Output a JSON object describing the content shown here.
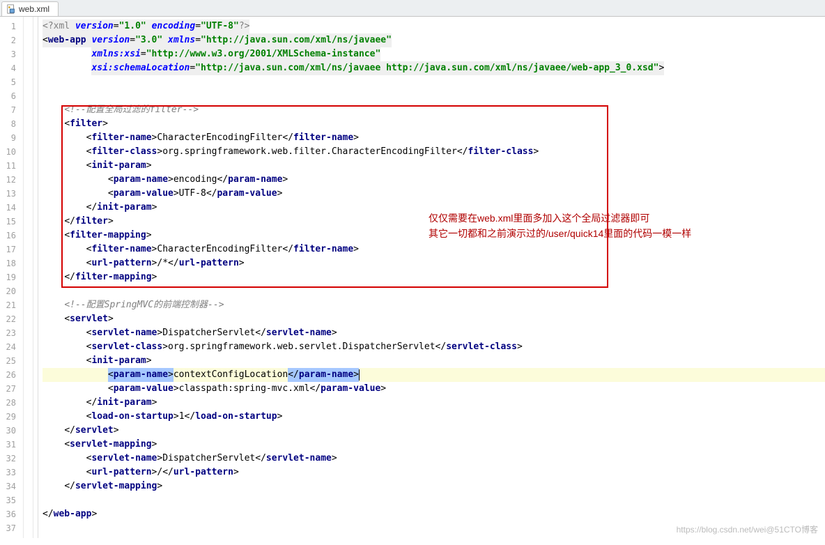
{
  "tab": {
    "title": "web.xml"
  },
  "gutter": {
    "start": 1,
    "end": 37
  },
  "highlight_line": 26,
  "red_box": {
    "from": 7,
    "to": 19
  },
  "annotation": {
    "line1": "仅仅需要在web.xml里面多加入这个全局过滤器即可",
    "line2": "其它一切都和之前演示过的/user/quick14里面的代码一模一样"
  },
  "watermark": "https://blog.csdn.net/wei@51CTO博客",
  "code": {
    "lines": [
      {
        "n": 1,
        "ind": 0,
        "seg": [
          {
            "c": "t-decl bg-decl",
            "t": "<?xml"
          },
          {
            "c": "bg-decl",
            "t": " "
          },
          {
            "c": "t-attr bg-decl",
            "t": "version"
          },
          {
            "c": "bg-decl",
            "t": "="
          },
          {
            "c": "t-str bg-decl",
            "t": "\"1.0\""
          },
          {
            "c": "bg-decl",
            "t": " "
          },
          {
            "c": "t-attr bg-decl",
            "t": "encoding"
          },
          {
            "c": "bg-decl",
            "t": "="
          },
          {
            "c": "t-str bg-decl",
            "t": "\"UTF-8\""
          },
          {
            "c": "t-decl bg-decl",
            "t": "?>"
          }
        ]
      },
      {
        "n": 2,
        "ind": 0,
        "seg": [
          {
            "c": "t-punct bg-decl",
            "t": "<"
          },
          {
            "c": "t-tag bg-decl",
            "t": "web-app"
          },
          {
            "c": "bg-decl",
            "t": " "
          },
          {
            "c": "t-attr bg-decl",
            "t": "version"
          },
          {
            "c": "bg-decl",
            "t": "="
          },
          {
            "c": "t-str bg-decl",
            "t": "\"3.0\""
          },
          {
            "c": "bg-decl",
            "t": " "
          },
          {
            "c": "t-attr bg-decl",
            "t": "xmlns"
          },
          {
            "c": "bg-decl",
            "t": "="
          },
          {
            "c": "t-str bg-decl",
            "t": "\"http://java.sun.com/xml/ns/javaee\""
          }
        ]
      },
      {
        "n": 3,
        "ind": 9,
        "seg": [
          {
            "c": "t-attr bg-decl",
            "t": "xmlns:xsi"
          },
          {
            "c": "bg-decl",
            "t": "="
          },
          {
            "c": "t-str bg-decl",
            "t": "\"http://www.w3.org/2001/XMLSchema-instance\""
          }
        ]
      },
      {
        "n": 4,
        "ind": 9,
        "seg": [
          {
            "c": "t-attr bg-decl",
            "t": "xsi:schemaLocation"
          },
          {
            "c": "bg-decl",
            "t": "="
          },
          {
            "c": "t-str bg-decl",
            "t": "\"http://java.sun.com/xml/ns/javaee http://java.sun.com/xml/ns/javaee/web-app_3_0.xsd\""
          },
          {
            "c": "t-punct bg-decl",
            "t": ">"
          }
        ]
      },
      {
        "n": 5,
        "ind": 0,
        "seg": []
      },
      {
        "n": 6,
        "ind": 0,
        "seg": []
      },
      {
        "n": 7,
        "ind": 4,
        "seg": [
          {
            "c": "t-cmt",
            "t": "<!--配置全局过滤的filter-->"
          }
        ]
      },
      {
        "n": 8,
        "ind": 4,
        "seg": [
          {
            "c": "t-punct",
            "t": "<"
          },
          {
            "c": "t-tag",
            "t": "filter"
          },
          {
            "c": "t-punct",
            "t": ">"
          }
        ]
      },
      {
        "n": 9,
        "ind": 8,
        "seg": [
          {
            "c": "t-punct",
            "t": "<"
          },
          {
            "c": "t-tag",
            "t": "filter-name"
          },
          {
            "c": "t-punct",
            "t": ">"
          },
          {
            "c": "t-txt",
            "t": "CharacterEncodingFilter"
          },
          {
            "c": "t-punct",
            "t": "</"
          },
          {
            "c": "t-tag",
            "t": "filter-name"
          },
          {
            "c": "t-punct",
            "t": ">"
          }
        ]
      },
      {
        "n": 10,
        "ind": 8,
        "seg": [
          {
            "c": "t-punct",
            "t": "<"
          },
          {
            "c": "t-tag",
            "t": "filter-class"
          },
          {
            "c": "t-punct",
            "t": ">"
          },
          {
            "c": "t-txt",
            "t": "org.springframework.web.filter.CharacterEncodingFilter"
          },
          {
            "c": "t-punct",
            "t": "</"
          },
          {
            "c": "t-tag",
            "t": "filter-class"
          },
          {
            "c": "t-punct",
            "t": ">"
          }
        ]
      },
      {
        "n": 11,
        "ind": 8,
        "seg": [
          {
            "c": "t-punct",
            "t": "<"
          },
          {
            "c": "t-tag",
            "t": "init-param"
          },
          {
            "c": "t-punct",
            "t": ">"
          }
        ]
      },
      {
        "n": 12,
        "ind": 12,
        "seg": [
          {
            "c": "t-punct",
            "t": "<"
          },
          {
            "c": "t-tag",
            "t": "param-name"
          },
          {
            "c": "t-punct",
            "t": ">"
          },
          {
            "c": "t-txt",
            "t": "encoding"
          },
          {
            "c": "t-punct",
            "t": "</"
          },
          {
            "c": "t-tag",
            "t": "param-name"
          },
          {
            "c": "t-punct",
            "t": ">"
          }
        ]
      },
      {
        "n": 13,
        "ind": 12,
        "seg": [
          {
            "c": "t-punct",
            "t": "<"
          },
          {
            "c": "t-tag",
            "t": "param-value"
          },
          {
            "c": "t-punct",
            "t": ">"
          },
          {
            "c": "t-txt",
            "t": "UTF-8"
          },
          {
            "c": "t-punct",
            "t": "</"
          },
          {
            "c": "t-tag",
            "t": "param-value"
          },
          {
            "c": "t-punct",
            "t": ">"
          }
        ]
      },
      {
        "n": 14,
        "ind": 8,
        "seg": [
          {
            "c": "t-punct",
            "t": "</"
          },
          {
            "c": "t-tag",
            "t": "init-param"
          },
          {
            "c": "t-punct",
            "t": ">"
          }
        ]
      },
      {
        "n": 15,
        "ind": 4,
        "seg": [
          {
            "c": "t-punct",
            "t": "</"
          },
          {
            "c": "t-tag",
            "t": "filter"
          },
          {
            "c": "t-punct",
            "t": ">"
          }
        ]
      },
      {
        "n": 16,
        "ind": 4,
        "seg": [
          {
            "c": "t-punct",
            "t": "<"
          },
          {
            "c": "t-tag",
            "t": "filter-mapping"
          },
          {
            "c": "t-punct",
            "t": ">"
          }
        ]
      },
      {
        "n": 17,
        "ind": 8,
        "seg": [
          {
            "c": "t-punct",
            "t": "<"
          },
          {
            "c": "t-tag",
            "t": "filter-name"
          },
          {
            "c": "t-punct",
            "t": ">"
          },
          {
            "c": "t-txt",
            "t": "CharacterEncodingFilter"
          },
          {
            "c": "t-punct",
            "t": "</"
          },
          {
            "c": "t-tag",
            "t": "filter-name"
          },
          {
            "c": "t-punct",
            "t": ">"
          }
        ]
      },
      {
        "n": 18,
        "ind": 8,
        "seg": [
          {
            "c": "t-punct",
            "t": "<"
          },
          {
            "c": "t-tag",
            "t": "url-pattern"
          },
          {
            "c": "t-punct",
            "t": ">"
          },
          {
            "c": "t-txt",
            "t": "/*"
          },
          {
            "c": "t-punct",
            "t": "</"
          },
          {
            "c": "t-tag",
            "t": "url-pattern"
          },
          {
            "c": "t-punct",
            "t": ">"
          }
        ]
      },
      {
        "n": 19,
        "ind": 4,
        "seg": [
          {
            "c": "t-punct",
            "t": "</"
          },
          {
            "c": "t-tag",
            "t": "filter-mapping"
          },
          {
            "c": "t-punct",
            "t": ">"
          }
        ]
      },
      {
        "n": 20,
        "ind": 0,
        "seg": []
      },
      {
        "n": 21,
        "ind": 4,
        "seg": [
          {
            "c": "t-cmt",
            "t": "<!--配置SpringMVC的前端控制器-->"
          }
        ]
      },
      {
        "n": 22,
        "ind": 4,
        "seg": [
          {
            "c": "t-punct",
            "t": "<"
          },
          {
            "c": "t-tag",
            "t": "servlet"
          },
          {
            "c": "t-punct",
            "t": ">"
          }
        ]
      },
      {
        "n": 23,
        "ind": 8,
        "seg": [
          {
            "c": "t-punct",
            "t": "<"
          },
          {
            "c": "t-tag",
            "t": "servlet-name"
          },
          {
            "c": "t-punct",
            "t": ">"
          },
          {
            "c": "t-txt",
            "t": "DispatcherServlet"
          },
          {
            "c": "t-punct",
            "t": "</"
          },
          {
            "c": "t-tag",
            "t": "servlet-name"
          },
          {
            "c": "t-punct",
            "t": ">"
          }
        ]
      },
      {
        "n": 24,
        "ind": 8,
        "seg": [
          {
            "c": "t-punct",
            "t": "<"
          },
          {
            "c": "t-tag",
            "t": "servlet-class"
          },
          {
            "c": "t-punct",
            "t": ">"
          },
          {
            "c": "t-txt",
            "t": "org.springframework.web.servlet.DispatcherServlet"
          },
          {
            "c": "t-punct",
            "t": "</"
          },
          {
            "c": "t-tag",
            "t": "servlet-class"
          },
          {
            "c": "t-punct",
            "t": ">"
          }
        ]
      },
      {
        "n": 25,
        "ind": 8,
        "seg": [
          {
            "c": "t-punct",
            "t": "<"
          },
          {
            "c": "t-tag",
            "t": "init-param"
          },
          {
            "c": "t-punct",
            "t": ">"
          }
        ]
      },
      {
        "n": 26,
        "ind": 12,
        "seg": [
          {
            "c": "t-punct sel",
            "t": "<"
          },
          {
            "c": "t-tag sel",
            "t": "param-name"
          },
          {
            "c": "t-punct sel",
            "t": ">"
          },
          {
            "c": "t-txt",
            "t": "contextConfigLocation"
          },
          {
            "c": "t-punct sel",
            "t": "</"
          },
          {
            "c": "t-tag sel",
            "t": "param-name"
          },
          {
            "c": "t-punct sel",
            "t": ">"
          },
          {
            "c": "",
            "t": "",
            "cursor": true
          }
        ],
        "hl": true
      },
      {
        "n": 27,
        "ind": 12,
        "seg": [
          {
            "c": "t-punct",
            "t": "<"
          },
          {
            "c": "t-tag",
            "t": "param-value"
          },
          {
            "c": "t-punct",
            "t": ">"
          },
          {
            "c": "t-txt",
            "t": "classpath:spring-mvc.xml"
          },
          {
            "c": "t-punct",
            "t": "</"
          },
          {
            "c": "t-tag",
            "t": "param-value"
          },
          {
            "c": "t-punct",
            "t": ">"
          }
        ]
      },
      {
        "n": 28,
        "ind": 8,
        "seg": [
          {
            "c": "t-punct",
            "t": "</"
          },
          {
            "c": "t-tag",
            "t": "init-param"
          },
          {
            "c": "t-punct",
            "t": ">"
          }
        ]
      },
      {
        "n": 29,
        "ind": 8,
        "seg": [
          {
            "c": "t-punct",
            "t": "<"
          },
          {
            "c": "t-tag",
            "t": "load-on-startup"
          },
          {
            "c": "t-punct",
            "t": ">"
          },
          {
            "c": "t-txt",
            "t": "1"
          },
          {
            "c": "t-punct",
            "t": "</"
          },
          {
            "c": "t-tag",
            "t": "load-on-startup"
          },
          {
            "c": "t-punct",
            "t": ">"
          }
        ]
      },
      {
        "n": 30,
        "ind": 4,
        "seg": [
          {
            "c": "t-punct",
            "t": "</"
          },
          {
            "c": "t-tag",
            "t": "servlet"
          },
          {
            "c": "t-punct",
            "t": ">"
          }
        ]
      },
      {
        "n": 31,
        "ind": 4,
        "seg": [
          {
            "c": "t-punct",
            "t": "<"
          },
          {
            "c": "t-tag",
            "t": "servlet-mapping"
          },
          {
            "c": "t-punct",
            "t": ">"
          }
        ]
      },
      {
        "n": 32,
        "ind": 8,
        "seg": [
          {
            "c": "t-punct",
            "t": "<"
          },
          {
            "c": "t-tag",
            "t": "servlet-name"
          },
          {
            "c": "t-punct",
            "t": ">"
          },
          {
            "c": "t-txt",
            "t": "DispatcherServlet"
          },
          {
            "c": "t-punct",
            "t": "</"
          },
          {
            "c": "t-tag",
            "t": "servlet-name"
          },
          {
            "c": "t-punct",
            "t": ">"
          }
        ]
      },
      {
        "n": 33,
        "ind": 8,
        "seg": [
          {
            "c": "t-punct",
            "t": "<"
          },
          {
            "c": "t-tag",
            "t": "url-pattern"
          },
          {
            "c": "t-punct",
            "t": ">"
          },
          {
            "c": "t-txt",
            "t": "/"
          },
          {
            "c": "t-punct",
            "t": "</"
          },
          {
            "c": "t-tag",
            "t": "url-pattern"
          },
          {
            "c": "t-punct",
            "t": ">"
          }
        ]
      },
      {
        "n": 34,
        "ind": 4,
        "seg": [
          {
            "c": "t-punct",
            "t": "</"
          },
          {
            "c": "t-tag",
            "t": "servlet-mapping"
          },
          {
            "c": "t-punct",
            "t": ">"
          }
        ]
      },
      {
        "n": 35,
        "ind": 0,
        "seg": []
      },
      {
        "n": 36,
        "ind": 0,
        "seg": [
          {
            "c": "t-punct",
            "t": "</"
          },
          {
            "c": "t-tag",
            "t": "web-app"
          },
          {
            "c": "t-punct",
            "t": ">"
          }
        ]
      },
      {
        "n": 37,
        "ind": 0,
        "seg": []
      }
    ]
  }
}
